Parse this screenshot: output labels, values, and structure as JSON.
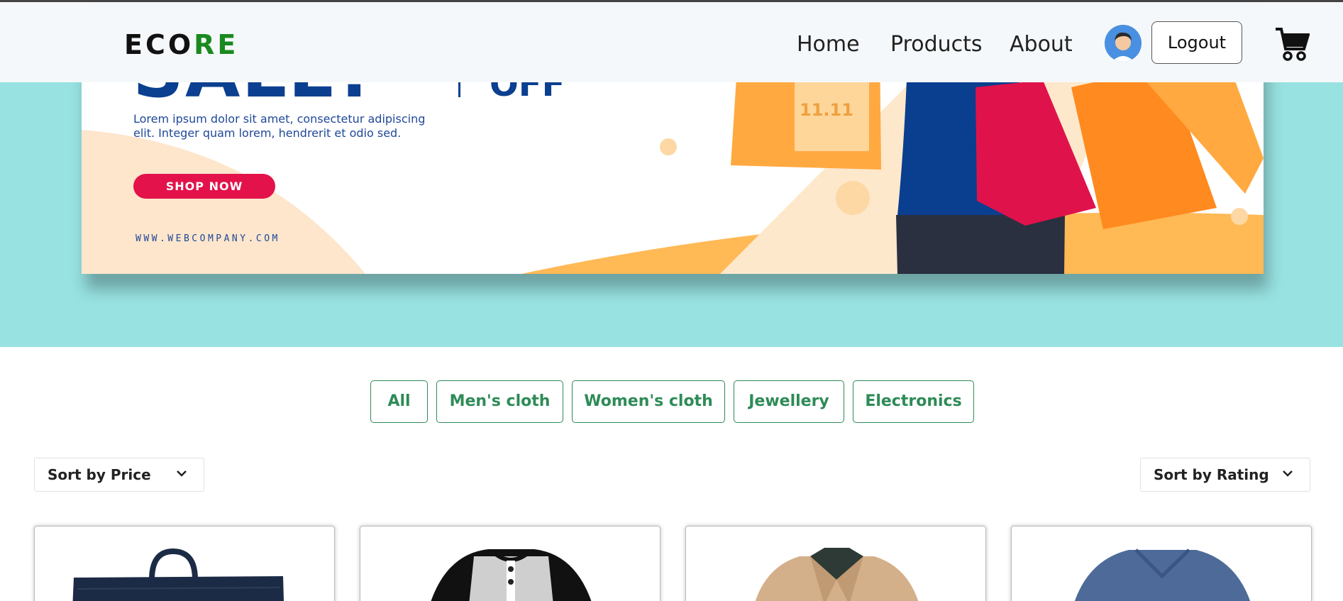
{
  "navbar": {
    "brand_part1": "ECO",
    "brand_part2": "RE",
    "links": [
      "Home",
      "Products",
      "About"
    ],
    "logout_label": "Logout",
    "avatar_icon": "user-avatar-icon",
    "cart_icon": "shopping-cart-icon"
  },
  "banner": {
    "sale_text": "SALE!",
    "off_text": "OFF",
    "description": "Lorem ipsum dolor sit amet, consectetur adipiscing elit. Integer quam lorem, hendrerit et odio sed.",
    "cta": "SHOP NOW",
    "url": "WWW.WEBCOMPANY.COM",
    "bag_label": "11.11"
  },
  "filters": [
    "All",
    "Men's cloth",
    "Women's cloth",
    "Jewellery",
    "Electronics"
  ],
  "sort": {
    "price_label": "Sort by Price",
    "rating_label": "Sort by Rating"
  },
  "colors": {
    "brand_green": "#1a8a1f",
    "filter_green": "#2e8b57",
    "hero_bg": "#98e2e2",
    "navbar_bg": "#f5f8fa",
    "banner_blue": "#0b3f8f",
    "cta_red": "#e3124b"
  },
  "products": [
    {
      "image": "navy-backpack"
    },
    {
      "image": "raglan-henley-tshirt"
    },
    {
      "image": "beige-jacket"
    },
    {
      "image": "blue-vneck-tshirt"
    }
  ]
}
